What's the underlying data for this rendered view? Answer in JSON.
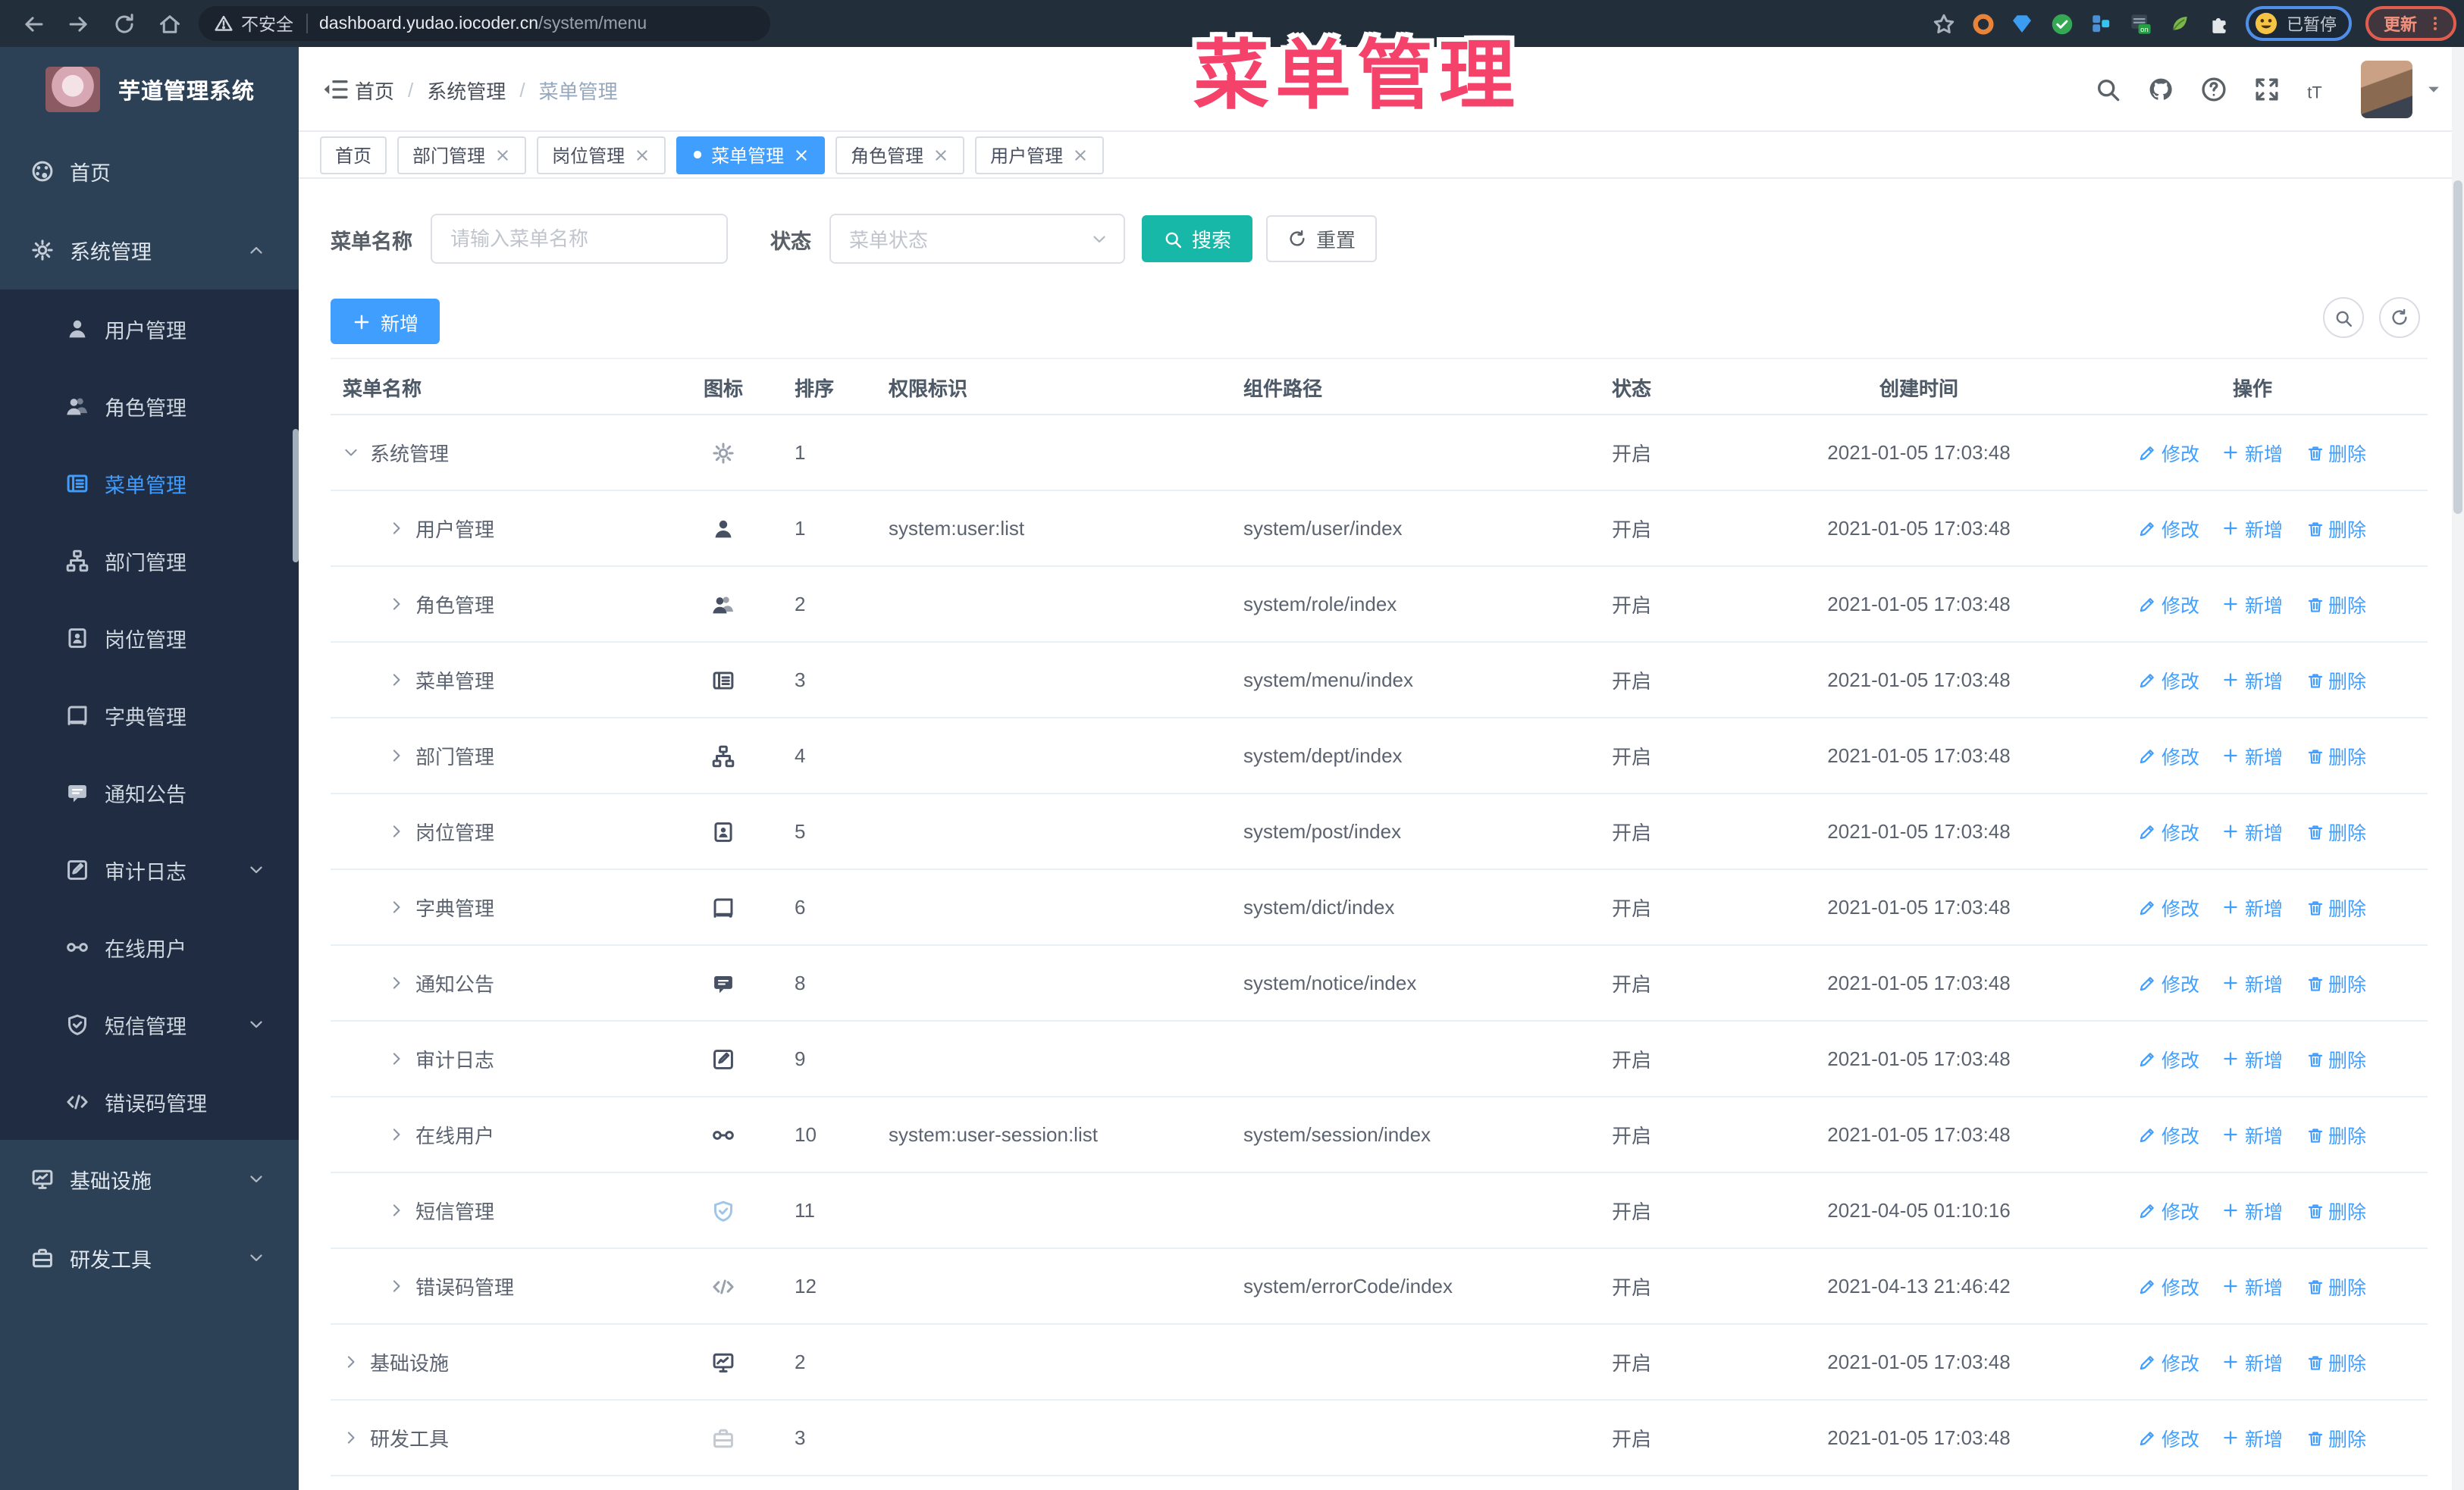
{
  "browser": {
    "security_label": "不安全",
    "url_host": "dashboard.yudao.iocoder.cn",
    "url_path": "/system/menu",
    "paused_badge": "已暂停",
    "update_button": "更新",
    "nav_icons": [
      "back-arrow-icon",
      "forward-arrow-icon",
      "reload-icon",
      "home-icon"
    ],
    "extension_icons": [
      "orange-ring-icon",
      "blue-gem-icon",
      "green-check-icon",
      "blue-grid-icon",
      "on-badge-icon",
      "green-leaf-icon",
      "puzzle-icon"
    ]
  },
  "overlay": {
    "title": "菜单管理",
    "color": "#f4426b"
  },
  "sidebar": {
    "app_title": "芋道管理系统",
    "items": [
      {
        "key": "home",
        "label": "首页",
        "icon": "dashboard-icon",
        "level": 0
      },
      {
        "key": "system",
        "label": "系统管理",
        "icon": "gear-icon",
        "level": 0,
        "chevron": "up"
      },
      {
        "key": "users",
        "label": "用户管理",
        "icon": "user-icon",
        "level": 1
      },
      {
        "key": "roles",
        "label": "角色管理",
        "icon": "users-icon",
        "level": 1
      },
      {
        "key": "menus",
        "label": "菜单管理",
        "icon": "menu-list-icon",
        "level": 1,
        "active": true
      },
      {
        "key": "depts",
        "label": "部门管理",
        "icon": "tree-icon",
        "level": 1
      },
      {
        "key": "posts",
        "label": "岗位管理",
        "icon": "badge-icon",
        "level": 1
      },
      {
        "key": "dicts",
        "label": "字典管理",
        "icon": "book-icon",
        "level": 1
      },
      {
        "key": "notices",
        "label": "通知公告",
        "icon": "message-icon",
        "level": 1
      },
      {
        "key": "audit-log",
        "label": "审计日志",
        "icon": "log-icon",
        "level": 1,
        "chevron": "down"
      },
      {
        "key": "online-users",
        "label": "在线用户",
        "icon": "key-icon",
        "level": 1
      },
      {
        "key": "sms",
        "label": "短信管理",
        "icon": "shield-icon",
        "level": 1,
        "chevron": "down"
      },
      {
        "key": "error-codes",
        "label": "错误码管理",
        "icon": "code-icon",
        "level": 1
      },
      {
        "key": "infra",
        "label": "基础设施",
        "icon": "monitor-icon",
        "level": 0,
        "chevron": "down"
      },
      {
        "key": "dev-tools",
        "label": "研发工具",
        "icon": "toolbox-icon",
        "level": 0,
        "chevron": "down"
      }
    ]
  },
  "navbar": {
    "breadcrumb": [
      "首页",
      "系统管理",
      "菜单管理"
    ],
    "right_icons": [
      "search-icon",
      "github-icon",
      "help-icon",
      "fullscreen-icon",
      "font-size-icon"
    ]
  },
  "tabs": [
    {
      "label": "首页",
      "closable": false,
      "active": false
    },
    {
      "label": "部门管理",
      "closable": true,
      "active": false
    },
    {
      "label": "岗位管理",
      "closable": true,
      "active": false
    },
    {
      "label": "菜单管理",
      "closable": true,
      "active": true
    },
    {
      "label": "角色管理",
      "closable": true,
      "active": false
    },
    {
      "label": "用户管理",
      "closable": true,
      "active": false
    }
  ],
  "filter": {
    "name_label": "菜单名称",
    "name_placeholder": "请输入菜单名称",
    "status_label": "状态",
    "status_placeholder": "菜单状态",
    "search_label": "搜索",
    "reset_label": "重置"
  },
  "toolbar": {
    "add_label": "新增"
  },
  "table": {
    "columns": [
      "菜单名称",
      "图标",
      "排序",
      "权限标识",
      "组件路径",
      "状态",
      "创建时间",
      "操作"
    ],
    "action_labels": {
      "edit": "修改",
      "add": "新增",
      "delete": "删除"
    },
    "rows": [
      {
        "name": "系统管理",
        "icon": "gear-icon",
        "icon_tone": "lite",
        "level": 0,
        "expanded": true,
        "sort": "1",
        "perm": "",
        "path": "",
        "status": "开启",
        "time": "2021-01-05 17:03:48"
      },
      {
        "name": "用户管理",
        "icon": "user-icon",
        "icon_tone": "",
        "level": 1,
        "expanded": false,
        "sort": "1",
        "perm": "system:user:list",
        "path": "system/user/index",
        "status": "开启",
        "time": "2021-01-05 17:03:48"
      },
      {
        "name": "角色管理",
        "icon": "users-icon",
        "icon_tone": "",
        "level": 1,
        "expanded": false,
        "sort": "2",
        "perm": "",
        "path": "system/role/index",
        "status": "开启",
        "time": "2021-01-05 17:03:48"
      },
      {
        "name": "菜单管理",
        "icon": "menu-list-icon",
        "icon_tone": "",
        "level": 1,
        "expanded": false,
        "sort": "3",
        "perm": "",
        "path": "system/menu/index",
        "status": "开启",
        "time": "2021-01-05 17:03:48"
      },
      {
        "name": "部门管理",
        "icon": "tree-icon",
        "icon_tone": "",
        "level": 1,
        "expanded": false,
        "sort": "4",
        "perm": "",
        "path": "system/dept/index",
        "status": "开启",
        "time": "2021-01-05 17:03:48"
      },
      {
        "name": "岗位管理",
        "icon": "badge-icon",
        "icon_tone": "",
        "level": 1,
        "expanded": false,
        "sort": "5",
        "perm": "",
        "path": "system/post/index",
        "status": "开启",
        "time": "2021-01-05 17:03:48"
      },
      {
        "name": "字典管理",
        "icon": "book-icon",
        "icon_tone": "",
        "level": 1,
        "expanded": false,
        "sort": "6",
        "perm": "",
        "path": "system/dict/index",
        "status": "开启",
        "time": "2021-01-05 17:03:48"
      },
      {
        "name": "通知公告",
        "icon": "message-icon",
        "icon_tone": "",
        "level": 1,
        "expanded": false,
        "sort": "8",
        "perm": "",
        "path": "system/notice/index",
        "status": "开启",
        "time": "2021-01-05 17:03:48"
      },
      {
        "name": "审计日志",
        "icon": "log-icon",
        "icon_tone": "",
        "level": 1,
        "expanded": false,
        "sort": "9",
        "perm": "",
        "path": "",
        "status": "开启",
        "time": "2021-01-05 17:03:48"
      },
      {
        "name": "在线用户",
        "icon": "key-icon",
        "icon_tone": "",
        "level": 1,
        "expanded": false,
        "sort": "10",
        "perm": "system:user-session:list",
        "path": "system/session/index",
        "status": "开启",
        "time": "2021-01-05 17:03:48"
      },
      {
        "name": "短信管理",
        "icon": "shield-icon",
        "icon_tone": "blue",
        "level": 1,
        "expanded": false,
        "sort": "11",
        "perm": "",
        "path": "",
        "status": "开启",
        "time": "2021-04-05 01:10:16"
      },
      {
        "name": "错误码管理",
        "icon": "code-icon",
        "icon_tone": "lite",
        "level": 1,
        "expanded": false,
        "sort": "12",
        "perm": "",
        "path": "system/errorCode/index",
        "status": "开启",
        "time": "2021-04-13 21:46:42"
      },
      {
        "name": "基础设施",
        "icon": "monitor-icon",
        "icon_tone": "",
        "level": 0,
        "expanded": false,
        "sort": "2",
        "perm": "",
        "path": "",
        "status": "开启",
        "time": "2021-01-05 17:03:48"
      },
      {
        "name": "研发工具",
        "icon": "toolbox-icon",
        "icon_tone": "faint",
        "level": 0,
        "expanded": false,
        "sort": "3",
        "perm": "",
        "path": "",
        "status": "开启",
        "time": "2021-01-05 17:03:48"
      }
    ]
  },
  "colors": {
    "accent": "#409eff",
    "search_button": "#17b8a8",
    "sidebar_bg": "#2c4156",
    "submenu_bg": "#1f2c41"
  }
}
